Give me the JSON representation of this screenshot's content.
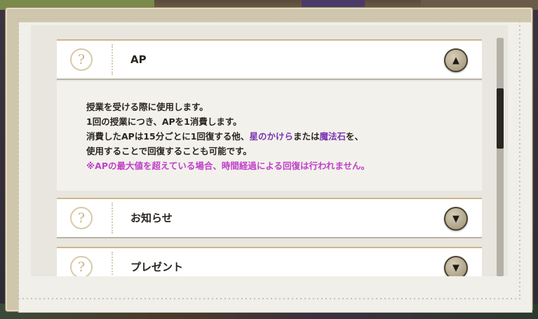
{
  "accordion": {
    "items": [
      {
        "title": "AP",
        "icon": "question-mark-icon",
        "toggle_icon": "chevron-up-icon",
        "expanded": true,
        "body": {
          "line1": "授業を受ける際に使用します。",
          "line2": "1回の授業につき、APを1消費します。",
          "line3_prefix": "消費したAPは15分ごとに1回復する他、",
          "line3_item1": "星のかけら",
          "line3_middle": "または",
          "line3_item2": "魔法石",
          "line3_suffix": "を、",
          "line4": "使用することで回復することも可能です。",
          "note": "※APの最大値を超えている場合、時間経過による回復は行われません。"
        }
      },
      {
        "title": "お知らせ",
        "icon": "question-mark-icon",
        "toggle_icon": "chevron-down-icon",
        "expanded": false
      },
      {
        "title": "プレゼント",
        "icon": "question-mark-icon",
        "toggle_icon": "chevron-down-icon",
        "expanded": false
      }
    ],
    "question_glyph": "?",
    "up_glyph": "▲",
    "down_glyph": "▼"
  },
  "colors": {
    "highlight_item": "#7a35b0",
    "note": "#c040c8",
    "frame": "#cfc6ae",
    "panel": "#f1efe9"
  }
}
